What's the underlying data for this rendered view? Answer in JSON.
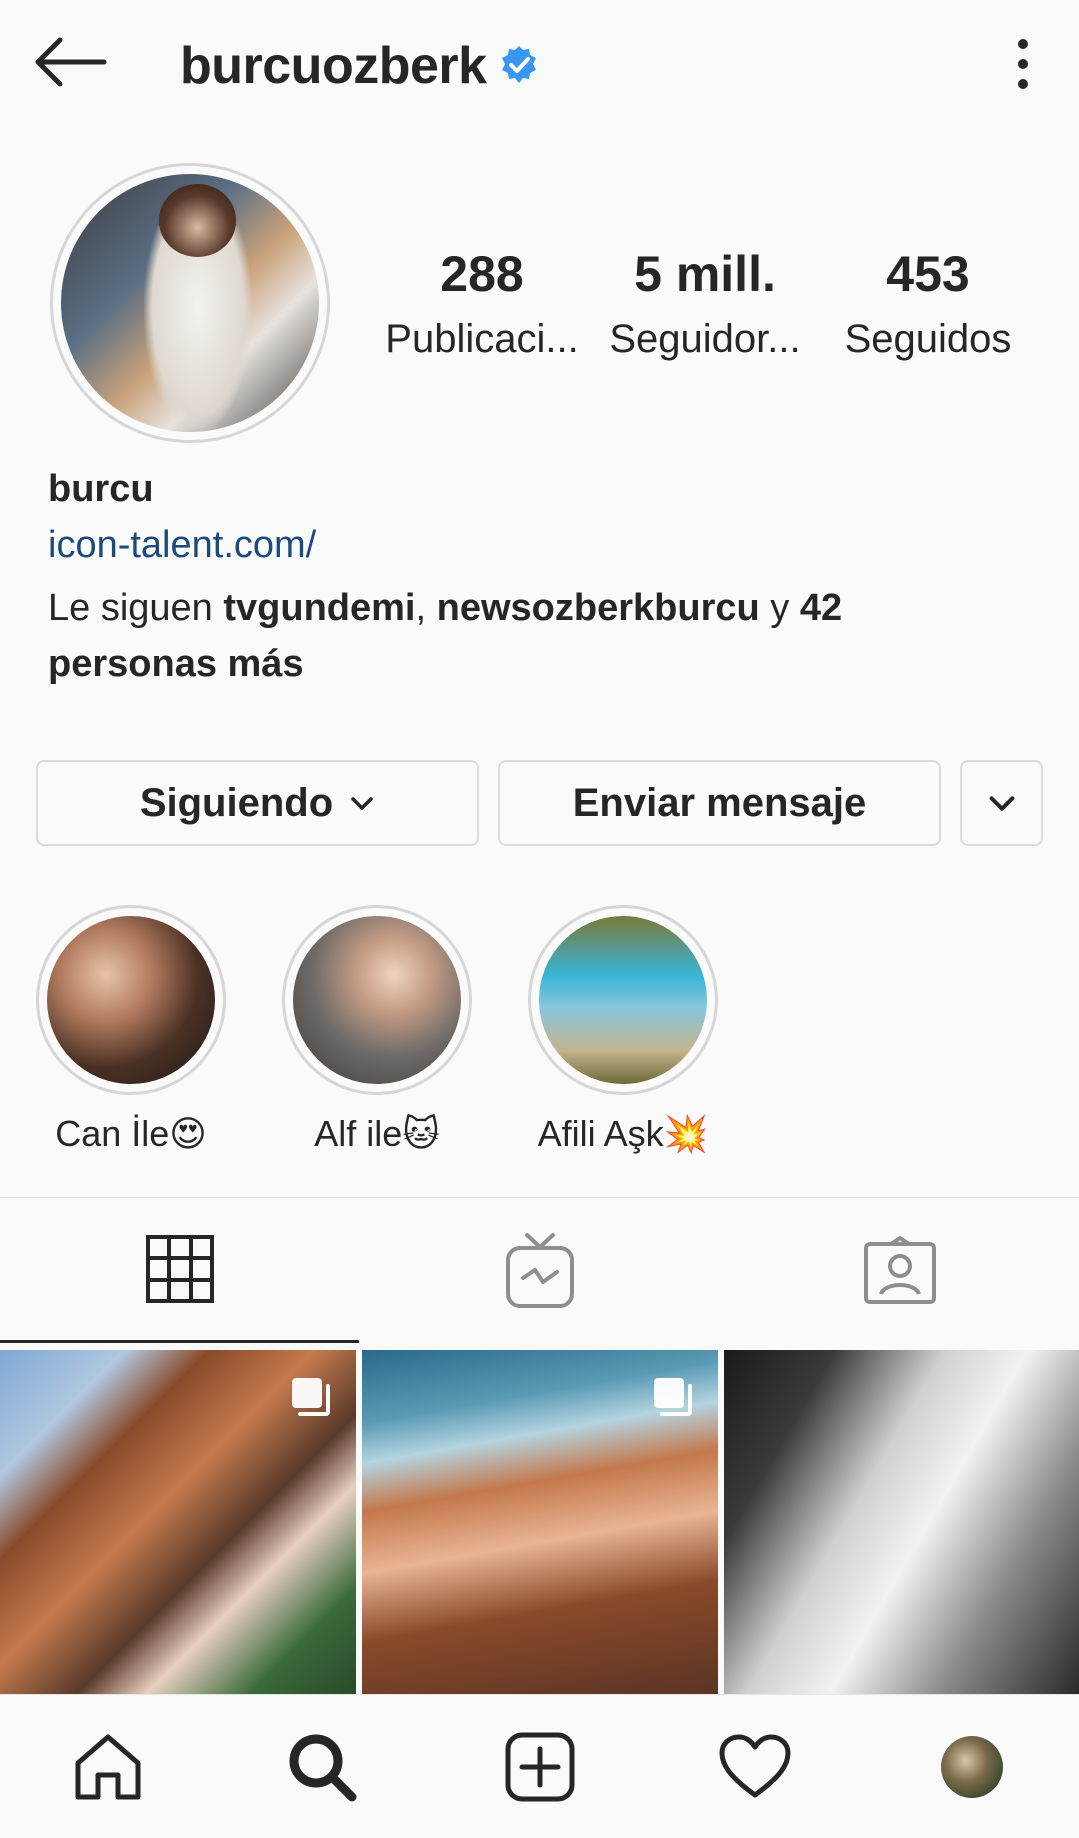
{
  "header": {
    "username": "burcuozberk",
    "verified_icon": "verified-badge-icon",
    "back_icon": "arrow-left-icon",
    "more_icon": "more-vertical-icon"
  },
  "stats": [
    {
      "value": "288",
      "label": "Publicaci..."
    },
    {
      "value": "5 mill.",
      "label": "Seguidor..."
    },
    {
      "value": "453",
      "label": "Seguidos"
    }
  ],
  "bio": {
    "name": "burcu",
    "link": "icon-talent.com/",
    "followed_prefix": "Le siguen ",
    "followed_user1": "tvgundemi",
    "followed_sep": ", ",
    "followed_user2": "newsozberkburcu",
    "followed_and": " y ",
    "followed_more": "42 personas más"
  },
  "actions": {
    "following_label": "Siguiendo",
    "message_label": "Enviar mensaje"
  },
  "highlights": [
    {
      "label": "Can İle😍"
    },
    {
      "label": "Alf ile🐱"
    },
    {
      "label": "Afili Aşk💥"
    }
  ],
  "tabs": [
    "grid-icon",
    "igtv-icon",
    "tagged-icon"
  ],
  "colors": {
    "background": "#fafafa",
    "text": "#262626",
    "link": "#1c4a7a",
    "verified": "#3897f0",
    "border": "#dbdbdb"
  },
  "bottom_nav": [
    "home-icon",
    "search-icon",
    "add-post-icon",
    "heart-icon",
    "profile-avatar"
  ]
}
